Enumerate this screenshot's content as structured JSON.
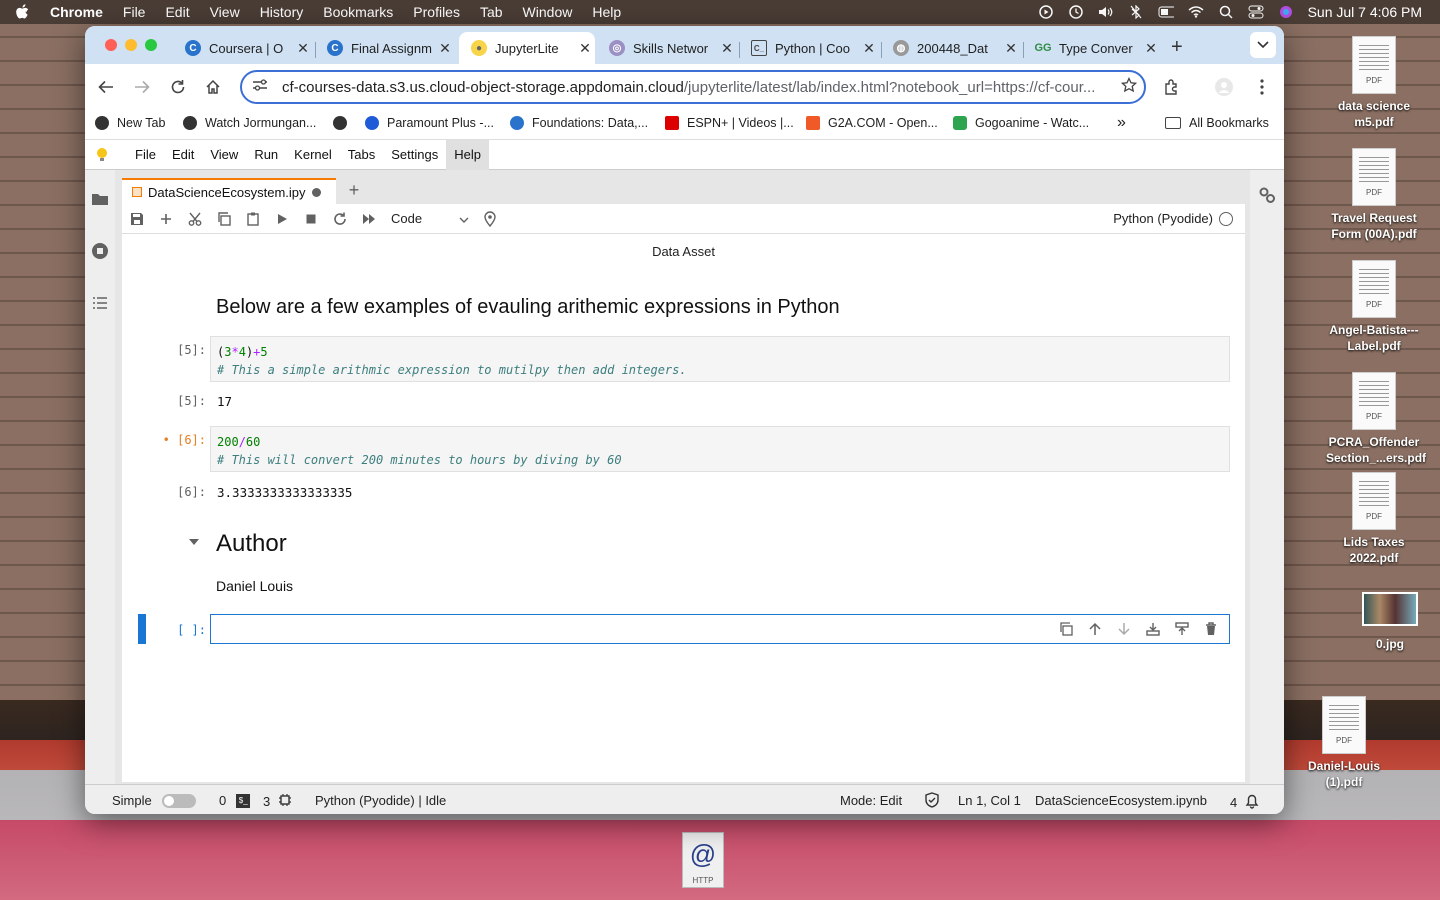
{
  "menubar": {
    "app": "Chrome",
    "items": [
      "File",
      "Edit",
      "View",
      "History",
      "Bookmarks",
      "Profiles",
      "Tab",
      "Window",
      "Help"
    ],
    "datetime": "Sun Jul 7  4:06 PM"
  },
  "desktop": {
    "icons": [
      {
        "label": "data science m5.pdf"
      },
      {
        "label": "Travel Request Form (00A).pdf"
      },
      {
        "label": "Angel-Batista---Label.pdf"
      },
      {
        "label": "PCRA_Offender Section_...ers.pdf"
      },
      {
        "label": "Lids Taxes 2022.pdf"
      },
      {
        "label": "0.jpg"
      },
      {
        "label": "Daniel-Louis (1).pdf"
      }
    ],
    "dock_icon": {
      "label": "HTTP",
      "glyph": "@"
    }
  },
  "browser": {
    "tabs": [
      {
        "title": "Coursera | O",
        "favicon": "coursera"
      },
      {
        "title": "Final Assignm",
        "favicon": "coursera"
      },
      {
        "title": "JupyterLite",
        "favicon": "jupyter"
      },
      {
        "title": "Skills Networ",
        "favicon": "skills"
      },
      {
        "title": "Python | Coo",
        "favicon": "code"
      },
      {
        "title": "200448_Dat",
        "favicon": "globe"
      },
      {
        "title": "Type Conver",
        "favicon": "gfg"
      }
    ],
    "url_host": "cf-courses-data.s3.us.cloud-object-storage.appdomain.cloud",
    "url_path": "/jupyterlite/latest/lab/index.html?notebook_url=https://cf-cour...",
    "bookmarks": [
      {
        "label": "New Tab"
      },
      {
        "label": "Watch Jormungan..."
      },
      {
        "label": ""
      },
      {
        "label": "Paramount Plus -..."
      },
      {
        "label": "Foundations: Data,..."
      },
      {
        "label": "ESPN+ | Videos |..."
      },
      {
        "label": "G2A.COM - Open..."
      },
      {
        "label": "Gogoanime - Watc..."
      }
    ],
    "bookmarks_overflow": "»",
    "all_bookmarks": "All Bookmarks"
  },
  "jupyter": {
    "menu": [
      "File",
      "Edit",
      "View",
      "Run",
      "Kernel",
      "Tabs",
      "Settings",
      "Help"
    ],
    "notebook_tab": "DataScienceEcosystem.ipy",
    "cell_type": "Code",
    "kernel": "Python (Pyodide)",
    "data_asset_label": "Data Asset",
    "heading": "Below are a few examples of evauling arithemic expressions in Python",
    "cells": [
      {
        "prompt": "[5]:",
        "code_tokens": [
          {
            "t": "(",
            "c": "p"
          },
          {
            "t": "3",
            "c": "n"
          },
          {
            "t": "*",
            "c": "o"
          },
          {
            "t": "4",
            "c": "n"
          },
          {
            "t": ")",
            "c": "p"
          },
          {
            "t": "+",
            "c": "o"
          },
          {
            "t": "5",
            "c": "n"
          }
        ],
        "comment": "# This a simple arithmic expression to mutilpy then add integers.",
        "out_prompt": "[5]:",
        "output": "17"
      },
      {
        "prompt": "[6]:",
        "dirty_marker": "•",
        "code_tokens": [
          {
            "t": "200",
            "c": "n"
          },
          {
            "t": "/",
            "c": "o"
          },
          {
            "t": "60",
            "c": "n"
          }
        ],
        "comment": "# This will convert 200 minutes to hours by diving by 60",
        "out_prompt": "[6]:",
        "output": "3.3333333333333335"
      }
    ],
    "author_heading": "Author",
    "author_name": "Daniel Louis",
    "empty_prompt": "[ ]:",
    "status": {
      "mode_label": "Simple",
      "count_a": "0",
      "count_b": "3",
      "kernel_status": "Python (Pyodide) | Idle",
      "mode": "Mode: Edit",
      "position": "Ln 1, Col 1",
      "filename": "DataScienceEcosystem.ipynb",
      "notifications": "4"
    }
  },
  "colors": {
    "tabstrip": "#cfe1f3",
    "accent": "#1976d2",
    "notebook_tab": "#f57c00"
  }
}
